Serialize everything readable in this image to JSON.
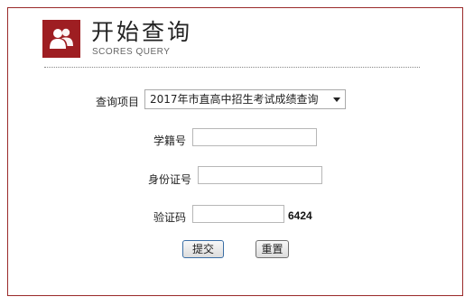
{
  "header": {
    "title": "开始查询",
    "subtitle": "SCORES QUERY",
    "icon": "users-icon",
    "accent_color": "#9e1e22"
  },
  "form": {
    "project_label": "查询项目",
    "project_selected": "2017年市直高中招生考试成绩查询",
    "student_id_label": "学籍号",
    "student_id_value": "",
    "id_card_label": "身份证号",
    "id_card_value": "",
    "captcha_label": "验证码",
    "captcha_value": "",
    "captcha_code": "6424"
  },
  "buttons": {
    "submit_label": "提交",
    "reset_label": "重置"
  }
}
